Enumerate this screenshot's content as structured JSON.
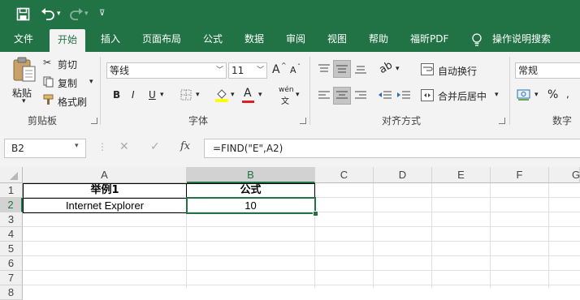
{
  "app": {
    "tabs": [
      "文件",
      "开始",
      "插入",
      "页面布局",
      "公式",
      "数据",
      "审阅",
      "视图",
      "帮助",
      "福昕PDF",
      "操作说明搜索"
    ],
    "active_tab": "开始"
  },
  "ribbon": {
    "clipboard": {
      "paste": "粘贴",
      "cut": "剪切",
      "copy": "复制",
      "format_painter": "格式刷",
      "group": "剪贴板"
    },
    "font": {
      "name": "等线",
      "size": "11",
      "bold": "B",
      "italic": "I",
      "underline": "U",
      "group": "字体",
      "grow": "A",
      "shrink": "A",
      "phonetic": "wén"
    },
    "alignment": {
      "wrap_text": "自动换行",
      "merge_center": "合并后居中",
      "group": "对齐方式"
    },
    "number": {
      "format": "常规",
      "percent": "%",
      "group": "数字"
    }
  },
  "formula_bar": {
    "name_box": "B2",
    "fx_label": "fx",
    "formula": "=FIND(\"E\",A2)"
  },
  "sheet": {
    "columns": [
      "A",
      "B",
      "C",
      "D",
      "E",
      "F",
      "G"
    ],
    "rows": [
      "1",
      "2",
      "3",
      "4",
      "5",
      "6",
      "7",
      "8"
    ],
    "selected_cell": "B2",
    "cells": {
      "A1": "举例1",
      "B1": "公式",
      "A2": "Internet Explorer",
      "B2": "10"
    }
  },
  "colors": {
    "accent": "#217346",
    "ribbon_bg": "#f3f3f3",
    "header_bg": "#f0f0f0"
  }
}
